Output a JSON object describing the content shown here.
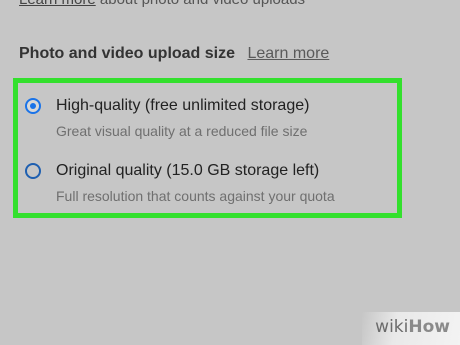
{
  "header": {
    "learn_more": "Learn more",
    "rest": " about photo and video uploads"
  },
  "upload_size": {
    "title": "Photo and video upload size",
    "learn_more": "Learn more",
    "options": [
      {
        "label": "High-quality (free unlimited storage)",
        "description": "Great visual quality at a reduced file size",
        "selected": true
      },
      {
        "label": "Original quality (15.0 GB storage left)",
        "description": "Full resolution that counts against your quota",
        "selected": false
      }
    ]
  },
  "watermark": {
    "wiki": "wiki",
    "how": "How"
  },
  "colors": {
    "background": "#c6c6c6",
    "highlight_border": "#33e02d",
    "radio_accent": "#1a73e8"
  }
}
